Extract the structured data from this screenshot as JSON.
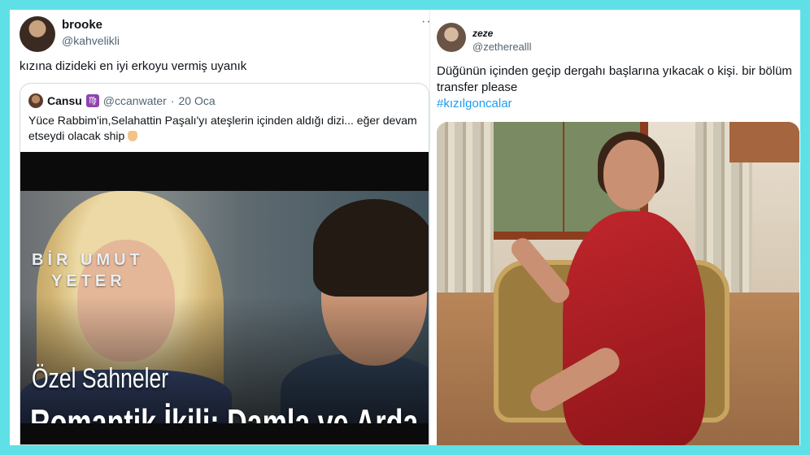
{
  "left_tweet": {
    "name": "brooke",
    "handle": "@kahvelikli",
    "more": "···",
    "text": "kızına dizideki en iyi erkoyu vermiş uyanık",
    "quote": {
      "name": "Cansu",
      "zodiac": "♍",
      "handle": "@ccanwater",
      "separator": "·",
      "date": "20 Oca",
      "text": "Yüce Rabbim'in,Selahattin Paşalı'yı ateşlerin içinden aldığı dizi... eğer devam etseydi olacak ship",
      "media": {
        "logo_line1": "BİR UMUT",
        "logo_line2": "YETER",
        "subtitle": "Özel Sahneler",
        "title": "Romantik İkili: Damla ve Arda"
      }
    }
  },
  "right_tweet": {
    "name": "zeze",
    "handle": "@zetherealll",
    "text": "Düğünün içinden geçip dergahı başlarına yıkacak o kişi. bir bölüm transfer please",
    "hashtag": "#kızılgoncalar"
  },
  "colors": {
    "background": "#5fe0e6",
    "link": "#1d9bf0",
    "secondary_text": "#536471"
  }
}
